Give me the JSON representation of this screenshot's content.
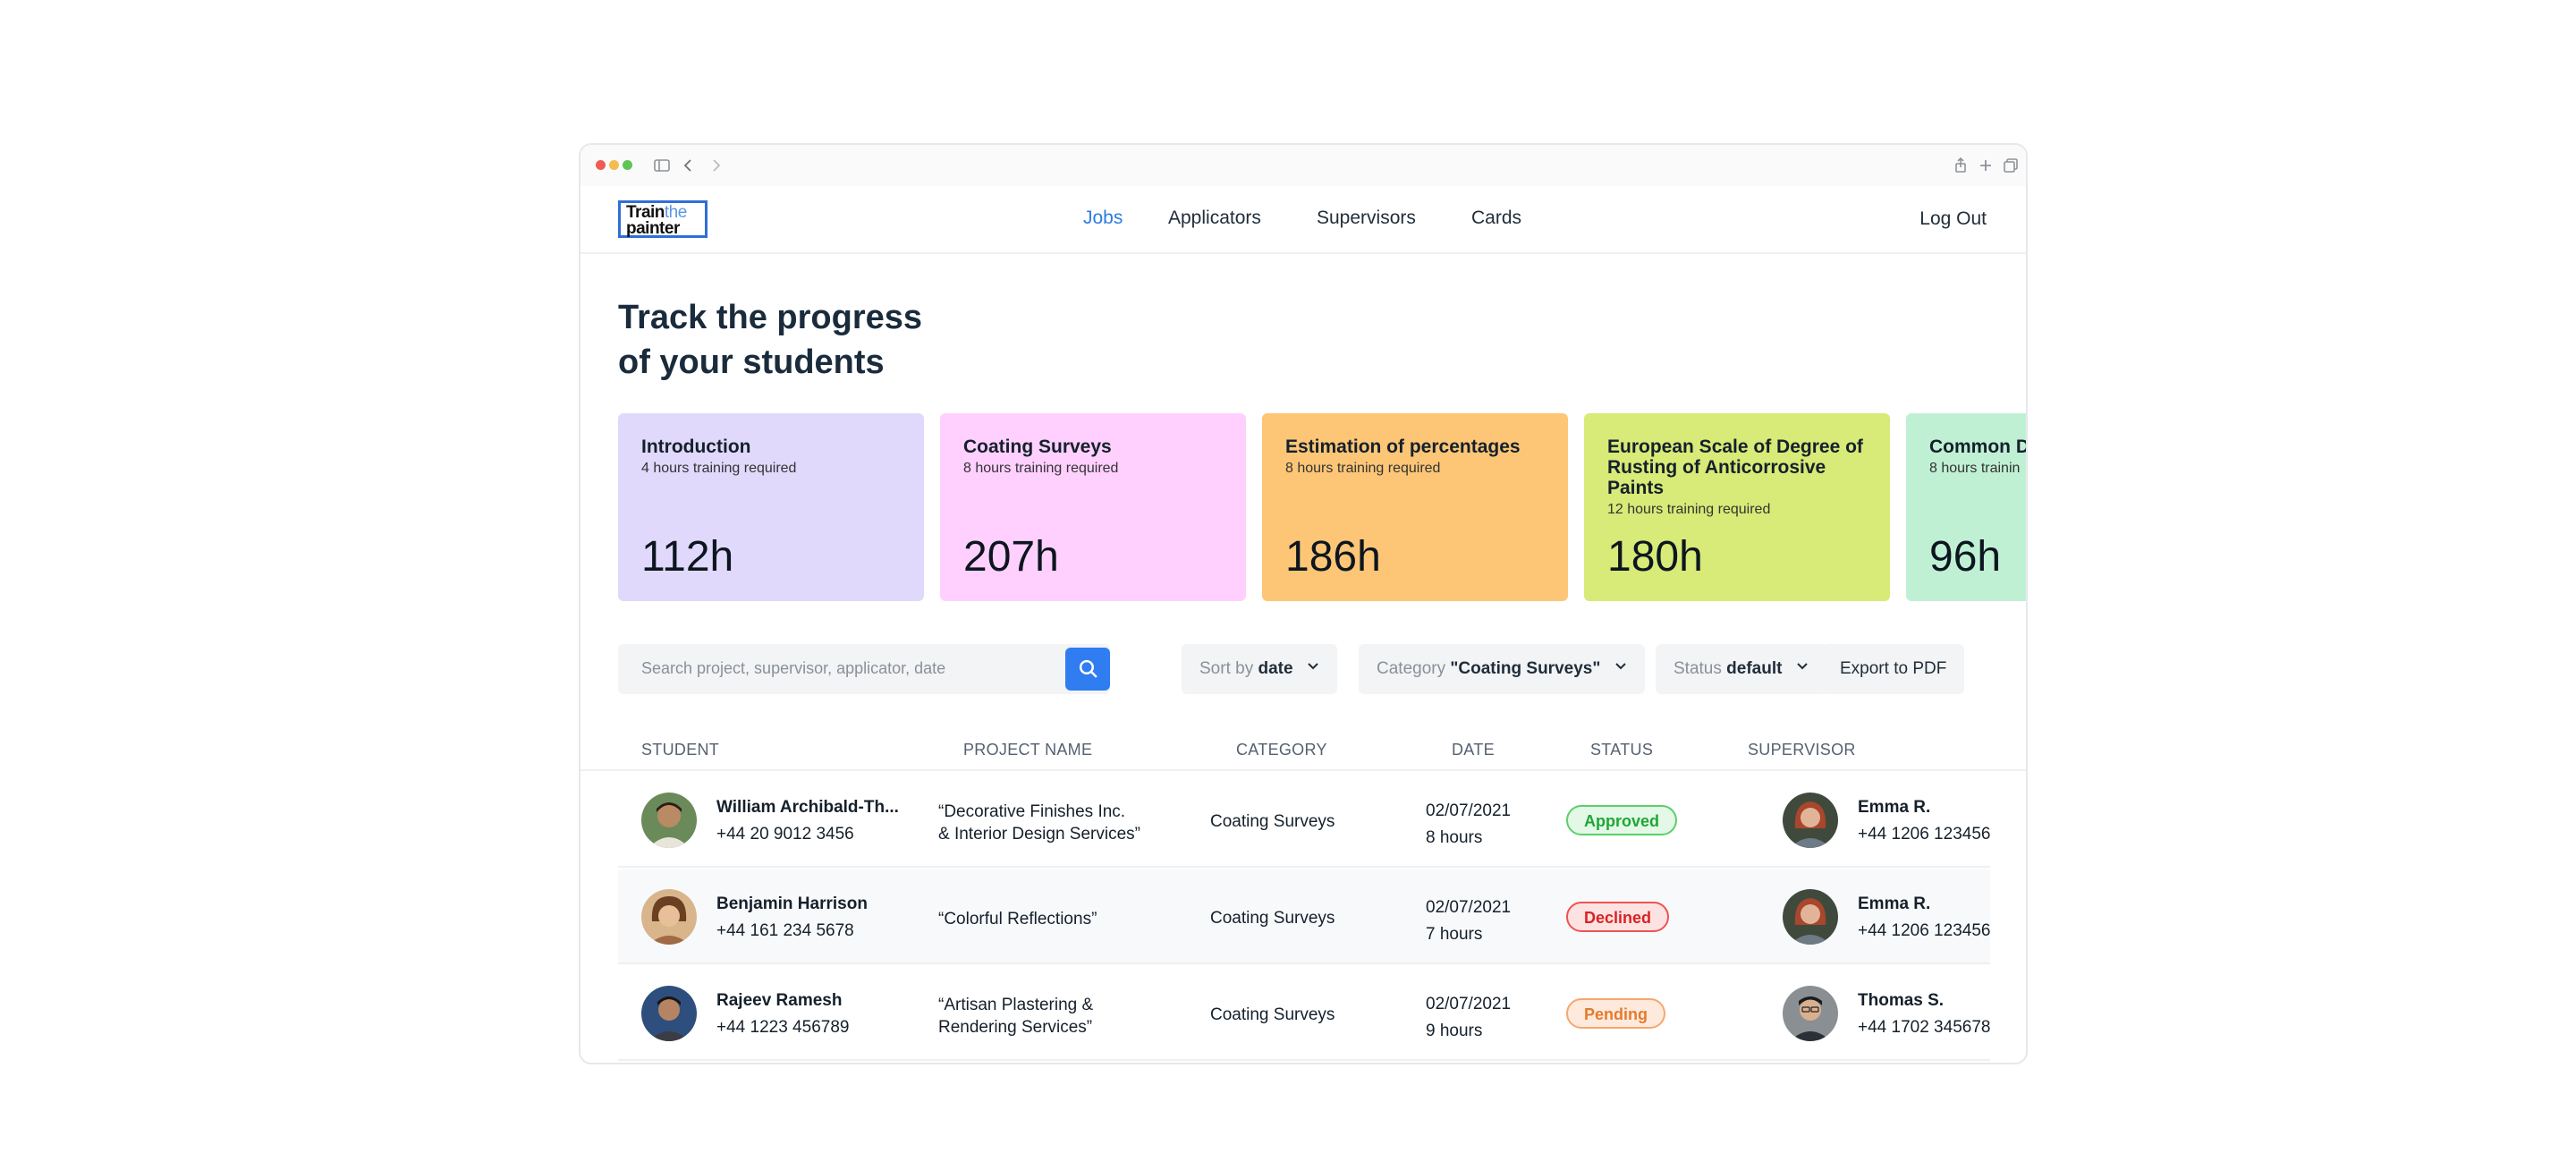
{
  "nav": {
    "logo_line1_a": "Train",
    "logo_line1_b": "the",
    "logo_line2": "painter",
    "links": [
      "Jobs",
      "Applicators",
      "Supervisors",
      "Cards"
    ],
    "active": "Jobs",
    "logout": "Log Out"
  },
  "headline": {
    "line1": "Track the progress",
    "line2": "of your students"
  },
  "cards": [
    {
      "title": "Introduction",
      "subtitle": "4 hours training required",
      "value": "112h",
      "color": "#e0d9fc"
    },
    {
      "title": "Coating Surveys",
      "subtitle": "8 hours training required",
      "value": "207h",
      "color": "#ffd0fe"
    },
    {
      "title": "Estimation of percentages",
      "subtitle": "8 hours training required",
      "value": "186h",
      "color": "#fdc676"
    },
    {
      "title": "European Scale of Degree of Rusting of Anticorrosive Paints",
      "subtitle": "12 hours training required",
      "value": "180h",
      "color": "#d8ea77"
    },
    {
      "title": "Common D",
      "subtitle": "8 hours trainin",
      "value": "96h",
      "color": "#c0f0d4"
    }
  ],
  "search": {
    "placeholder": "Search project, supervisor, applicator, date"
  },
  "filters": {
    "sort_label": "Sort by",
    "sort_value": "date",
    "category_label": "Category",
    "category_value": "\"Coating Surveys\"",
    "status_label": "Status",
    "status_value": "default",
    "export": "Export to PDF"
  },
  "table": {
    "headers": [
      "STUDENT",
      "PROJECT NAME",
      "CATEGORY",
      "DATE",
      "STATUS",
      "SUPERVISOR"
    ],
    "rows": [
      {
        "student_name": "William Archibald-Th...",
        "student_phone": "+44 20 9012 3456",
        "project_line1": "“Decorative Finishes Inc.",
        "project_line2": "& Interior Design Services”",
        "category": "Coating Surveys",
        "date": "02/07/2021",
        "hours": "8 hours",
        "status": "Approved",
        "supervisor_name": "Emma R.",
        "supervisor_phone": "+44 1206 123456"
      },
      {
        "student_name": "Benjamin Harrison",
        "student_phone": "+44 161 234 5678",
        "project_line1": "“Colorful Reflections”",
        "project_line2": "",
        "category": "Coating Surveys",
        "date": "02/07/2021",
        "hours": "7 hours",
        "status": "Declined",
        "supervisor_name": "Emma R.",
        "supervisor_phone": "+44 1206 123456"
      },
      {
        "student_name": "Rajeev Ramesh",
        "student_phone": "+44 1223 456789",
        "project_line1": "“Artisan Plastering &",
        "project_line2": "Rendering Services”",
        "category": "Coating Surveys",
        "date": "02/07/2021",
        "hours": "9 hours",
        "status": "Pending",
        "supervisor_name": "Thomas S.",
        "supervisor_phone": "+44 1702 345678"
      }
    ]
  }
}
